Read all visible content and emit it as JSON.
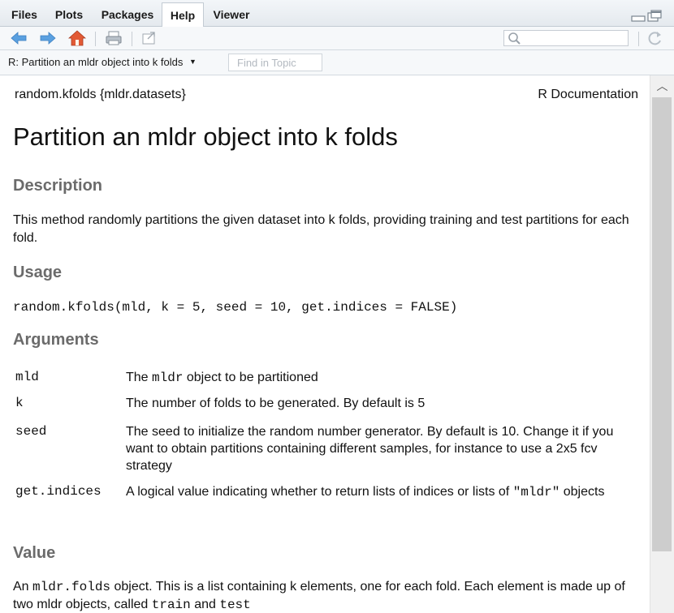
{
  "tabs": [
    {
      "label": "Files",
      "active": false
    },
    {
      "label": "Plots",
      "active": false
    },
    {
      "label": "Packages",
      "active": false
    },
    {
      "label": "Help",
      "active": true
    },
    {
      "label": "Viewer",
      "active": false
    }
  ],
  "toolbar": {
    "icons": [
      "back-arrow-icon",
      "forward-arrow-icon",
      "home-icon",
      "print-icon",
      "popout-icon",
      "search-icon",
      "refresh-icon"
    ]
  },
  "subbar": {
    "topic": "R: Partition an mldr object into k folds",
    "find_placeholder": "Find in Topic"
  },
  "doc": {
    "header_left": "random.kfolds {mldr.datasets}",
    "header_right": "R Documentation",
    "title": "Partition an mldr object into k folds",
    "description_heading": "Description",
    "description": "This method randomly partitions the given dataset into k folds, providing training and test partitions for each fold.",
    "usage_heading": "Usage",
    "usage": "random.kfolds(mld, k = 5, seed = 10, get.indices = FALSE)",
    "arguments_heading": "Arguments",
    "arguments": [
      {
        "name": "mld",
        "desc_pre": "The ",
        "desc_code": "mldr",
        "desc_post": " object to be partitioned"
      },
      {
        "name": "k",
        "desc": "The number of folds to be generated. By default is 5"
      },
      {
        "name": "seed",
        "desc": "The seed to initialize the random number generator. By default is 10. Change it if you want to obtain partitions containing different samples, for instance to use a 2x5 fcv strategy"
      },
      {
        "name": "get.indices",
        "desc_pre": "A logical value indicating whether to return lists of indices or lists of ",
        "desc_code": "\"mldr\"",
        "desc_post": " objects"
      }
    ],
    "value_heading": "Value",
    "value": {
      "pre": "An ",
      "code1": "mldr.folds",
      "mid": " object. This is a list containing k elements, one for each fold. Each element is made up of two mldr objects, called ",
      "code2": "train",
      "and": " and ",
      "code3": "test"
    }
  },
  "colors": {
    "heading": "#6b6b6b",
    "accent_blue": "#3c8dd6",
    "home_red": "#d04a2c"
  }
}
